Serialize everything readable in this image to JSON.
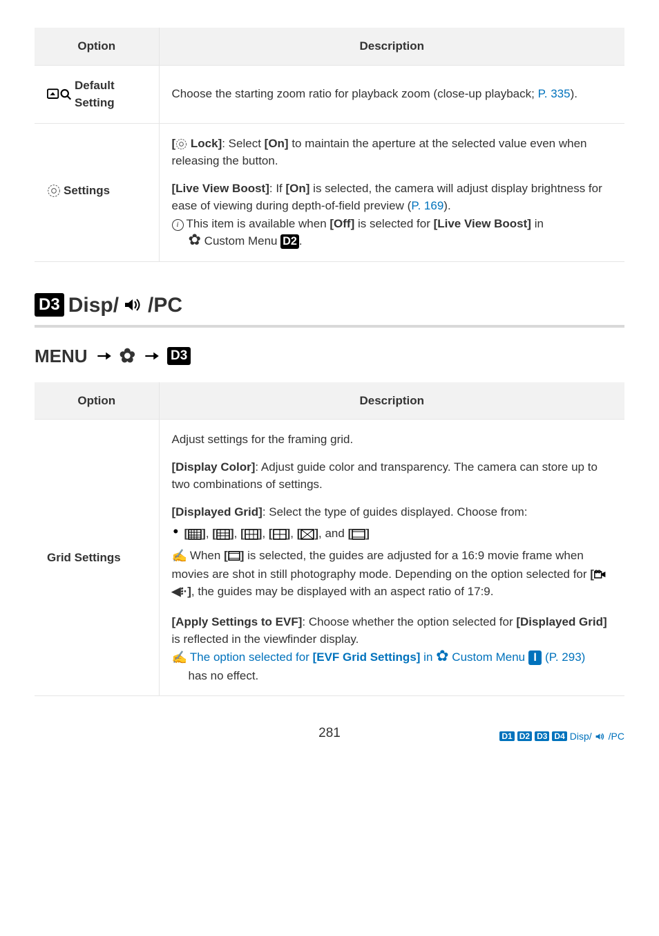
{
  "table1": {
    "headers": {
      "option": "Option",
      "description": "Description"
    },
    "row1": {
      "option_label": "Default Setting",
      "description": "Choose the starting zoom ratio for playback zoom (close-up playback; ",
      "description_link": "P. 335",
      "description_end": ")."
    },
    "row2": {
      "option_label": "Settings",
      "lock_prefix": "[",
      "lock_label": " Lock]",
      "lock_text": ": Select ",
      "on_label": "[On]",
      "lock_rest": " to maintain the aperture at the selected value even when releasing the button.",
      "lvb_label": "[Live View Boost]",
      "lvb_text1": ": If ",
      "lvb_on": "[On]",
      "lvb_text2": " is selected, the camera will adjust display brightness for ease of viewing during depth-of-field preview (",
      "lvb_link": "P. 169",
      "lvb_text3": ").",
      "note_text1": "This item is available when ",
      "note_off": "[Off]",
      "note_text2": " is selected for ",
      "note_lvb": "[Live View Boost]",
      "note_text3": " in",
      "note_custom": " Custom Menu ",
      "note_end": "."
    }
  },
  "section": {
    "d3": "D3",
    "d2": "D2",
    "title_rest": " Disp/",
    "title_end": "/PC",
    "menu_label": "MENU"
  },
  "table2": {
    "headers": {
      "option": "Option",
      "description": "Description"
    },
    "row1": {
      "option_label": "Grid Settings",
      "intro": "Adjust settings for the framing grid.",
      "dc_label": "[Display Color]",
      "dc_text": ": Adjust guide color and transparency. The camera can store up to two combinations of settings.",
      "dg_label": "[Displayed Grid]",
      "dg_text": ": Select the type of guides displayed. Choose from:",
      "dg_and": ", and ",
      "hint1a": "When ",
      "hint1b": " is selected, the guides are adjusted for a 16:9 movie frame when movies are shot in still photography mode. Depending on the option selected for ",
      "hint1c": ", the guides may be displayed with an aspect ratio of 17:9.",
      "apply_label": "[Apply Settings to EVF]",
      "apply_text1": ": Choose whether the option selected for ",
      "apply_dg": "[Displayed Grid]",
      "apply_text2": " is reflected in the viewfinder display.",
      "hint2a": "The option selected for ",
      "hint2_evf": "[EVF Grid Settings]",
      "hint2b": " in ",
      "hint2_custom": " Custom Menu ",
      "hint2_page": " (P. 293)",
      "hint2c": " has no effect.",
      "badge_i": "I"
    }
  },
  "footer": {
    "page": "281",
    "d1": "D1",
    "d2": "D2",
    "d3": "D3",
    "d4": "D4",
    "crumb_rest": "Disp/",
    "crumb_end": "/PC"
  }
}
